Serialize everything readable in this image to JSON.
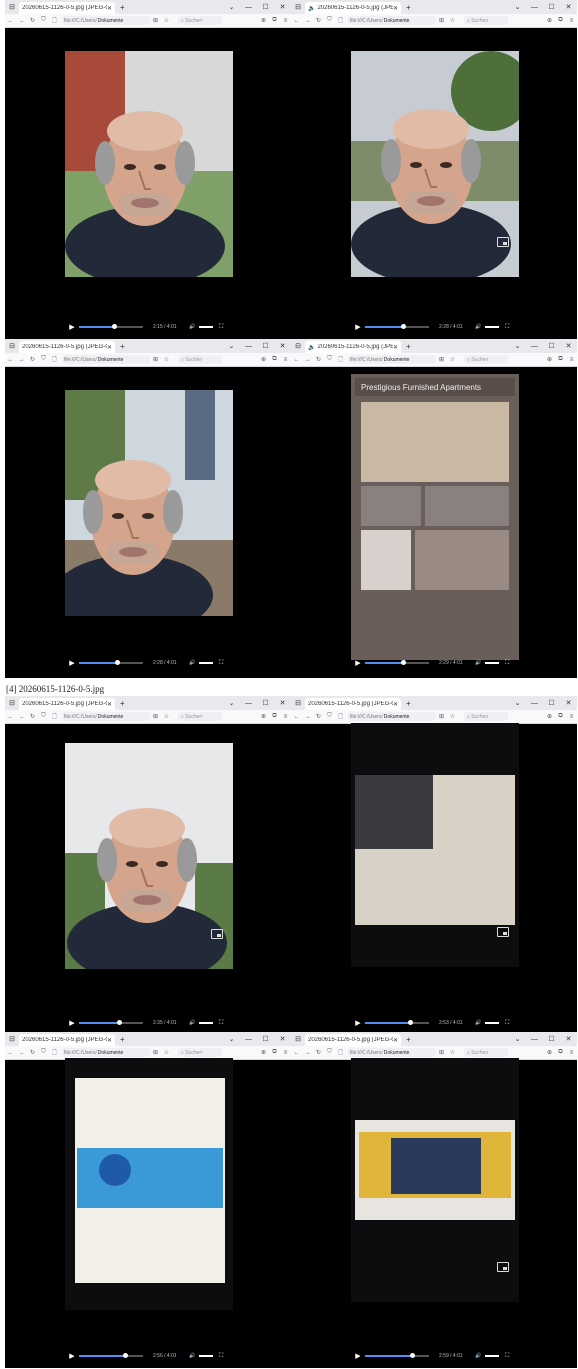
{
  "caption": "[4] 20260615-1126-0-5.jpg",
  "colors": {
    "chrome_tab_bar": "#e9e9ed",
    "chrome_nav": "#f9f9fb",
    "video_bg": "#000000",
    "progress": "#4f8ef7"
  },
  "browser": {
    "tab_title": "20260615-1126-0-5.jpg (JPEG-Grafik",
    "url_prefix": "file:///C:/Users/",
    "url_highlight": "Dokumente",
    "search_placeholder": "Suchen",
    "new_tab": "+",
    "window_controls": [
      "—",
      "☐",
      "✕"
    ]
  },
  "panels": [
    {
      "id": "p1",
      "time": "2:15 / 4:01",
      "progress": 0.55,
      "scene": "selfie-building",
      "speaker": false
    },
    {
      "id": "p2",
      "time": "2:28 / 4:01",
      "progress": 0.6,
      "scene": "selfie-river",
      "speaker": true
    },
    {
      "id": "p3",
      "time": "2:28 / 4:01",
      "progress": 0.6,
      "scene": "selfie-tower",
      "speaker": false
    },
    {
      "id": "p4",
      "time": "2:29 / 4:01",
      "progress": 0.6,
      "scene": "poster",
      "speaker": true,
      "sign_title": "Prestigious Furnished Apartments"
    },
    {
      "id": "p5",
      "time": "2:35 / 4:01",
      "progress": 0.63,
      "scene": "selfie-trees",
      "speaker": false
    },
    {
      "id": "p6",
      "time": "2:53 / 4:01",
      "progress": 0.7,
      "scene": "screen-article",
      "speaker": false
    },
    {
      "id": "p7",
      "time": "2:56 / 4:01",
      "progress": 0.72,
      "scene": "screen-football",
      "speaker": false
    },
    {
      "id": "p8",
      "time": "2:59 / 4:01",
      "progress": 0.73,
      "scene": "screen-band",
      "speaker": false
    }
  ]
}
